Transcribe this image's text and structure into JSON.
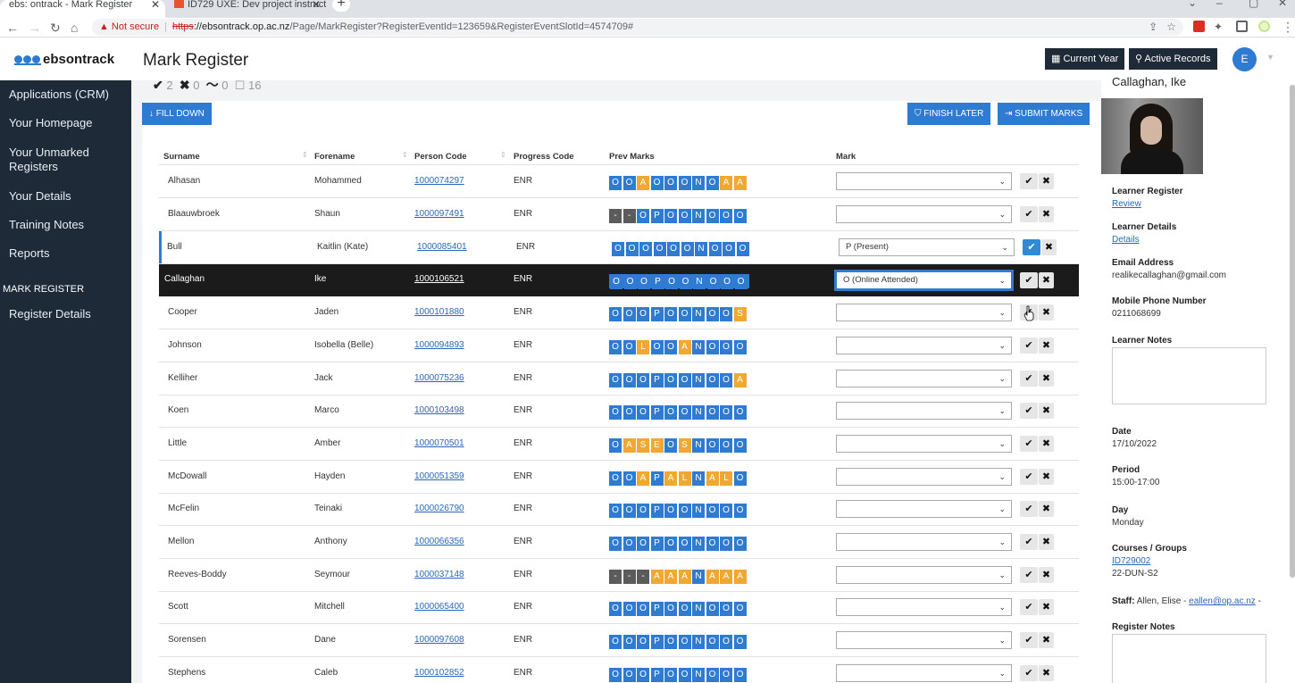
{
  "browser": {
    "tabs": [
      {
        "title": "ebs: ontrack - Mark Register",
        "active": true
      },
      {
        "title": "ID729 UXE: Dev project instructio",
        "active": false
      }
    ],
    "new_tab": "+",
    "url": {
      "warning": "Not secure",
      "protocol": "https",
      "host": "://ebsontrack.op.ac.nz",
      "path": "/Page/MarkRegister?RegisterEventId=123659&RegisterEventSlotId=4574709#"
    }
  },
  "header": {
    "logo": "ebsontrack",
    "title": "Mark Register",
    "current_year": "Current Year",
    "active_records": "Active Records",
    "avatar": "E"
  },
  "sidebar": {
    "items": [
      "Applications (CRM)",
      "Your Homepage",
      "Your Unmarked Registers",
      "Your Details",
      "Training Notes",
      "Reports"
    ],
    "section": "MARK REGISTER",
    "section_items": [
      "Register Details"
    ]
  },
  "stats": {
    "present": "2",
    "absent": "0",
    "other": "0",
    "unmarked": "16"
  },
  "actions": {
    "fill_down": "FILL DOWN",
    "finish_later": "FINISH LATER",
    "submit_marks": "SUBMIT MARKS"
  },
  "table": {
    "headers": [
      "Surname",
      "Forename",
      "Person Code",
      "Progress Code",
      "Prev Marks",
      "Mark"
    ],
    "rows": [
      {
        "surname": "Alhasan",
        "forename": "Mohammed",
        "code": "1000074297",
        "progress": "ENR",
        "marks": "OOAOOONOAA",
        "mark": ""
      },
      {
        "surname": "Blaauwbroek",
        "forename": "Shaun",
        "code": "1000097491",
        "progress": "ENR",
        "marks": "--OPOONOOO",
        "mark": ""
      },
      {
        "surname": "Bull",
        "forename": "Kaitlin (Kate)",
        "code": "1000085401",
        "progress": "ENR",
        "marks": "OOOOOONOOO",
        "mark": "P (Present)"
      },
      {
        "surname": "Callaghan",
        "forename": "Ike",
        "code": "1000106521",
        "progress": "ENR",
        "marks": "OOOPOONOOO",
        "mark": "O (Online Attended)"
      },
      {
        "surname": "Cooper",
        "forename": "Jaden",
        "code": "1000101880",
        "progress": "ENR",
        "marks": "OOOPOONOOS",
        "mark": ""
      },
      {
        "surname": "Johnson",
        "forename": "Isobella (Belle)",
        "code": "1000094893",
        "progress": "ENR",
        "marks": "OOLOOANOOO",
        "mark": ""
      },
      {
        "surname": "Kelliher",
        "forename": "Jack",
        "code": "1000075236",
        "progress": "ENR",
        "marks": "OOOPOONOOA",
        "mark": ""
      },
      {
        "surname": "Koen",
        "forename": "Marco",
        "code": "1000103498",
        "progress": "ENR",
        "marks": "OOOPOONOOO",
        "mark": ""
      },
      {
        "surname": "Little",
        "forename": "Amber",
        "code": "1000070501",
        "progress": "ENR",
        "marks": "OASEOSNOOO",
        "mark": ""
      },
      {
        "surname": "McDowall",
        "forename": "Hayden",
        "code": "1000051359",
        "progress": "ENR",
        "marks": "OOAPALNALO",
        "mark": ""
      },
      {
        "surname": "McFelin",
        "forename": "Teinaki",
        "code": "1000026790",
        "progress": "ENR",
        "marks": "OOOPOONOOO",
        "mark": ""
      },
      {
        "surname": "Mellon",
        "forename": "Anthony",
        "code": "1000066356",
        "progress": "ENR",
        "marks": "OOOPOONOOO",
        "mark": ""
      },
      {
        "surname": "Reeves-Boddy",
        "forename": "Seymour",
        "code": "1000037148",
        "progress": "ENR",
        "marks": "---AAANAAA",
        "mark": ""
      },
      {
        "surname": "Scott",
        "forename": "Mitchell",
        "code": "1000065400",
        "progress": "ENR",
        "marks": "OOOPOONOOO",
        "mark": ""
      },
      {
        "surname": "Sorensen",
        "forename": "Dane",
        "code": "1000097608",
        "progress": "ENR",
        "marks": "OOOPOONOOO",
        "mark": ""
      },
      {
        "surname": "Stephens",
        "forename": "Caleb",
        "code": "1000102852",
        "progress": "ENR",
        "marks": "OOOPOONOOO",
        "mark": ""
      }
    ]
  },
  "colors": {
    "mark_default": "#2f7bd1",
    "mark_absent": "#f0a830",
    "mark_none": "#5b5b5b",
    "sidebar": "#1e2a38"
  },
  "learner": {
    "name": "Callaghan, Ike",
    "register_label": "Learner Register",
    "register_link": "Review",
    "details_label": "Learner Details",
    "details_link": "Details",
    "email_label": "Email Address",
    "email": "realikecallaghan@gmail.com",
    "phone_label": "Mobile Phone Number",
    "phone": "0211068699",
    "notes_label": "Learner Notes",
    "date_label": "Date",
    "date": "17/10/2022",
    "period_label": "Period",
    "period": "15:00-17:00",
    "day_label": "Day",
    "day": "Monday",
    "courses_label": "Courses / Groups",
    "course_link": "ID729002",
    "course_group": "22-DUN-S2",
    "staff_label": "Staff:",
    "staff_name": "Allen, Elise -",
    "staff_email": "eallen@op.ac.nz",
    "staff_tail": "-",
    "register_notes_label": "Register Notes"
  }
}
